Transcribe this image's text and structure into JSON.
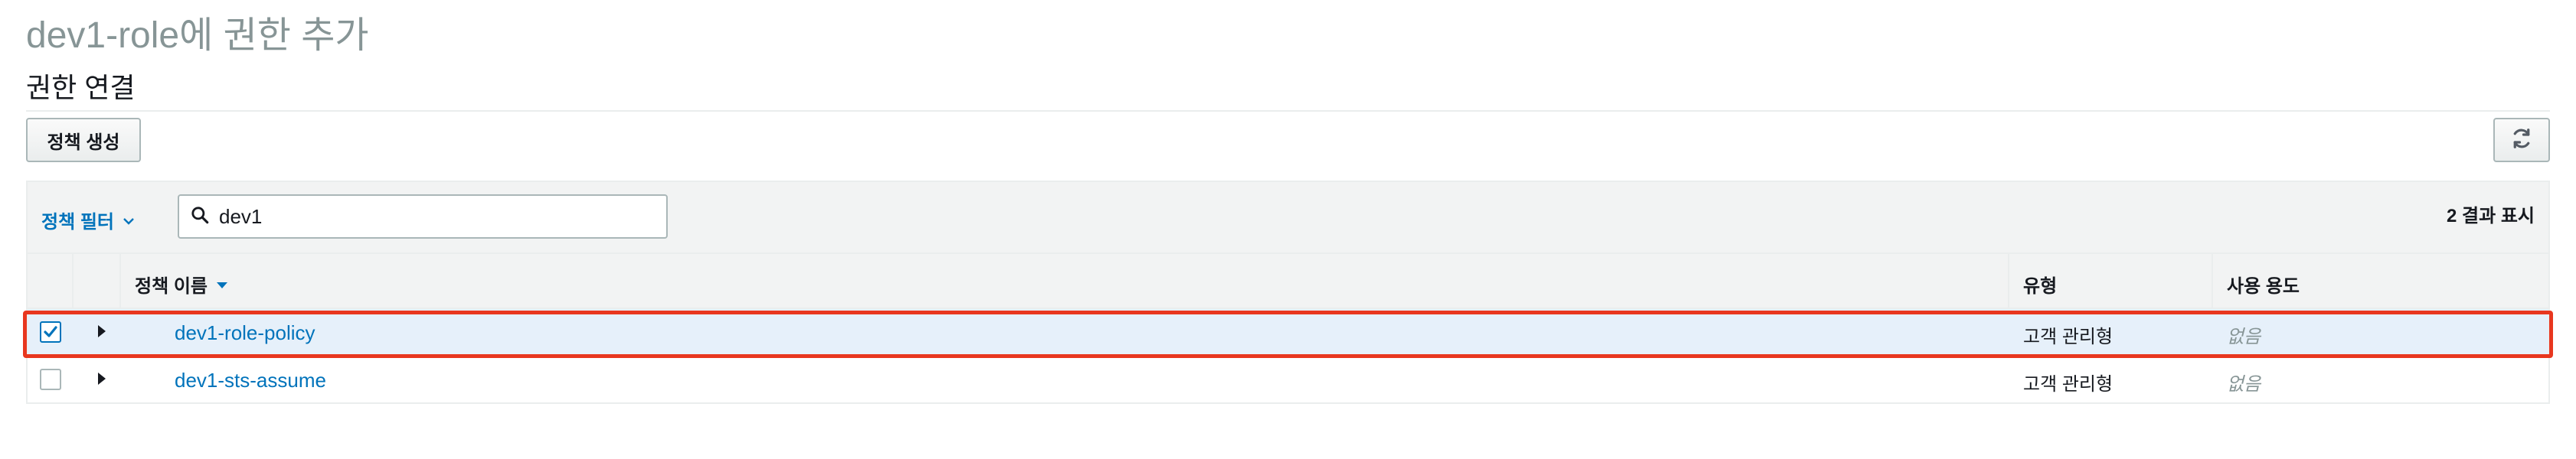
{
  "page": {
    "title": "dev1-role에 권한 추가",
    "section_title": "권한 연결"
  },
  "toolbar": {
    "create_policy_label": "정책 생성",
    "refresh_icon": "refresh-icon"
  },
  "filter": {
    "toggle_label": "정책 필터",
    "search_value": "dev1",
    "result_count": "2 결과 표시"
  },
  "table": {
    "columns": {
      "name": "정책 이름",
      "type": "유형",
      "usage": "사용 용도"
    },
    "rows": [
      {
        "name": "dev1-role-policy",
        "type": "고객 관리형",
        "usage": "없음",
        "checked": true
      },
      {
        "name": "dev1-sts-assume",
        "type": "고객 관리형",
        "usage": "없음",
        "checked": false
      }
    ]
  },
  "colors": {
    "link": "#0073bb",
    "selected_row": "#e6f0fa",
    "highlight": "#e8371f"
  }
}
